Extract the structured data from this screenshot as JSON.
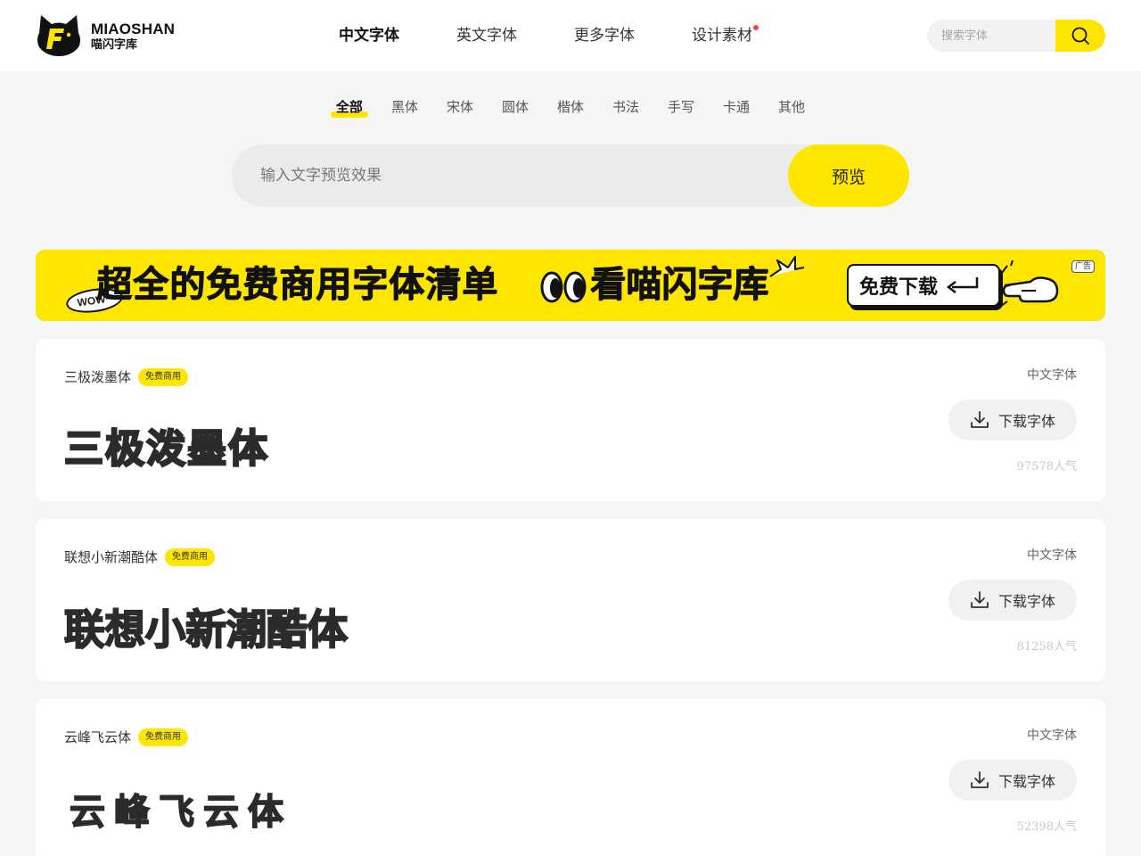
{
  "header": {
    "logo": {
      "en": "MIAOSHAN",
      "zh": "喵闪字库",
      "icon": "cat-f-logo-icon"
    },
    "nav": [
      {
        "label": "中文字体",
        "active": true
      },
      {
        "label": "英文字体",
        "active": false
      },
      {
        "label": "更多字体",
        "active": false
      },
      {
        "label": "设计素材",
        "active": false,
        "dot": true
      }
    ],
    "search": {
      "placeholder": "搜索字体",
      "icon": "search-icon"
    }
  },
  "categories": [
    {
      "label": "全部",
      "active": true
    },
    {
      "label": "黑体"
    },
    {
      "label": "宋体"
    },
    {
      "label": "圆体"
    },
    {
      "label": "楷体"
    },
    {
      "label": "书法"
    },
    {
      "label": "手写"
    },
    {
      "label": "卡通"
    },
    {
      "label": "其他"
    }
  ],
  "preview": {
    "placeholder": "输入文字预览效果",
    "button": "预览"
  },
  "banner": {
    "wow": "WOW~",
    "text1": "超全的免费商用字体清单",
    "text2": "看喵闪字库",
    "button": "免费下载",
    "ad_tag": "广告"
  },
  "fonts": [
    {
      "name": "三极泼墨体",
      "badge": "免费商用",
      "sample": "三极泼墨体",
      "type": "中文字体",
      "download": "下载字体",
      "popularity": "97578人气"
    },
    {
      "name": "联想小新潮酷体",
      "badge": "免费商用",
      "sample": "联想小新潮酷体",
      "type": "中文字体",
      "download": "下载字体",
      "popularity": "81258人气"
    },
    {
      "name": "云峰飞云体",
      "badge": "免费商用",
      "sample": "云峰飞云体",
      "type": "中文字体",
      "download": "下载字体",
      "popularity": "52398人气"
    }
  ],
  "colors": {
    "accent": "#ffe600",
    "background": "#f5f5f5",
    "card": "#ffffff",
    "dot": "#f24848"
  }
}
